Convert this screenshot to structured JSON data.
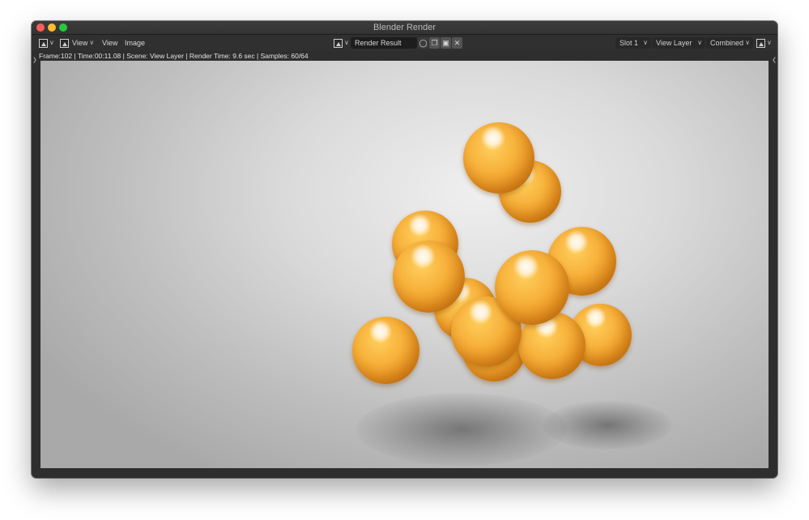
{
  "window": {
    "title": "Blender Render"
  },
  "header": {
    "editor_type_icon": "image-editor-icon",
    "view_menu": "View",
    "menus": [
      "View",
      "Image"
    ],
    "image_browse_icon": "image-browse-icon",
    "image_name": "Render Result",
    "icons": [
      "fake-user-shield-icon",
      "duplicate-image-icon",
      "open-folder-icon",
      "close-icon"
    ],
    "slot": "Slot 1",
    "view_layer": "View Layer",
    "pass": "Combined",
    "display_channels_icon": "display-channels-icon"
  },
  "status": {
    "text": "Frame:102 | Time:00:11.08 | Scene: View Layer | Render Time: 9.6 sec | Samples: 60/64"
  },
  "render": {
    "subject": "orange-glossy-spheres",
    "sphere_color": "#f7b23c",
    "background_color": "#d9d9d9"
  }
}
